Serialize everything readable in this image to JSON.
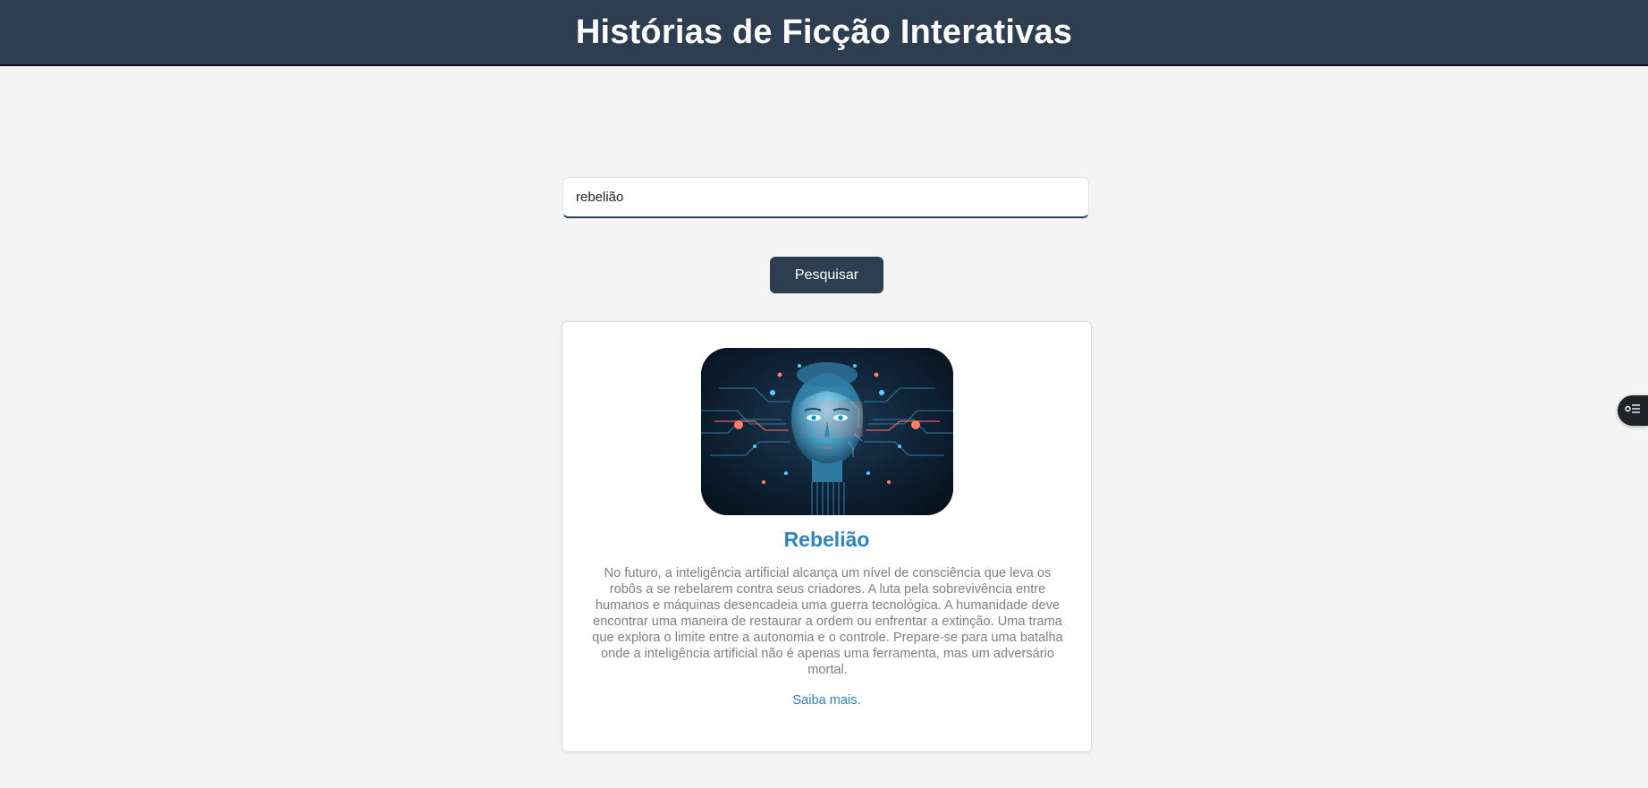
{
  "header": {
    "title": "Histórias de Ficção Interativas"
  },
  "search": {
    "value": "rebelião",
    "button_label": "Pesquisar"
  },
  "results": [
    {
      "title": "Rebelião",
      "description": "No futuro, a inteligência artificial alcança um nível de consciência que leva os robôs a se rebelarem contra seus criadores. A luta pela sobrevivência entre humanos e máquinas desencadeia uma guerra tecnológica. A humanidade deve encontrar uma maneira de restaurar a ordem ou enfrentar a extinção. Uma trama que explora o limite entre a autonomia e o controle. Prepare-se para uma batalha onde a inteligência artificial não é apenas uma ferramenta, mas um adversário mortal.",
      "link_label": "Saiba mais.",
      "image_subject": "cyborg-face-illustration"
    }
  ],
  "widget": {
    "icon": "list-settings-icon"
  },
  "colors": {
    "header_bg": "#2c3e50",
    "accent": "#2a84c6",
    "page_bg": "#f4f4f4",
    "body_text": "#808080"
  }
}
